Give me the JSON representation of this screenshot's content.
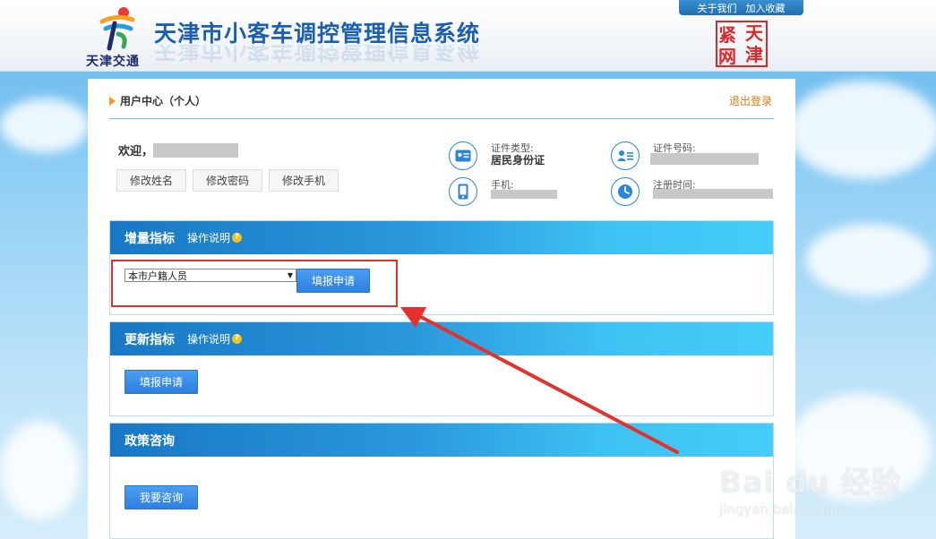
{
  "header": {
    "logo_text": "天津交通",
    "site_title": "天津市小客车调控管理信息系统",
    "top_links": [
      "关于我们",
      "加入收藏"
    ],
    "seal_text": [
      "天",
      "津",
      "紧",
      "网"
    ]
  },
  "user_center": {
    "title": "用户中心（个人）",
    "logout": "退出登录",
    "welcome": "欢迎，",
    "buttons": [
      "修改姓名",
      "修改密码",
      "修改手机"
    ],
    "info": {
      "id_type_label": "证件类型:",
      "id_type_value": "居民身份证",
      "id_number_label": "证件号码:",
      "phone_label": "手机:",
      "register_time_label": "注册时间:"
    }
  },
  "sections": {
    "increment": {
      "title": "增量指标",
      "help": "操作说明",
      "select_value": "本市户籍人员",
      "apply_button": "填报申请"
    },
    "renewal": {
      "title": "更新指标",
      "help": "操作说明",
      "apply_button": "填报申请"
    },
    "policy": {
      "title": "政策咨询",
      "consult_button": "我要咨询"
    }
  },
  "watermark": {
    "main": "Bai du 经验",
    "sub": "jingyan.baidu.com"
  },
  "colors": {
    "section_blue": "#1877c4",
    "button_blue": "#2f7fe0",
    "highlight_red": "#e4312c",
    "logout_orange": "#e07b14"
  }
}
